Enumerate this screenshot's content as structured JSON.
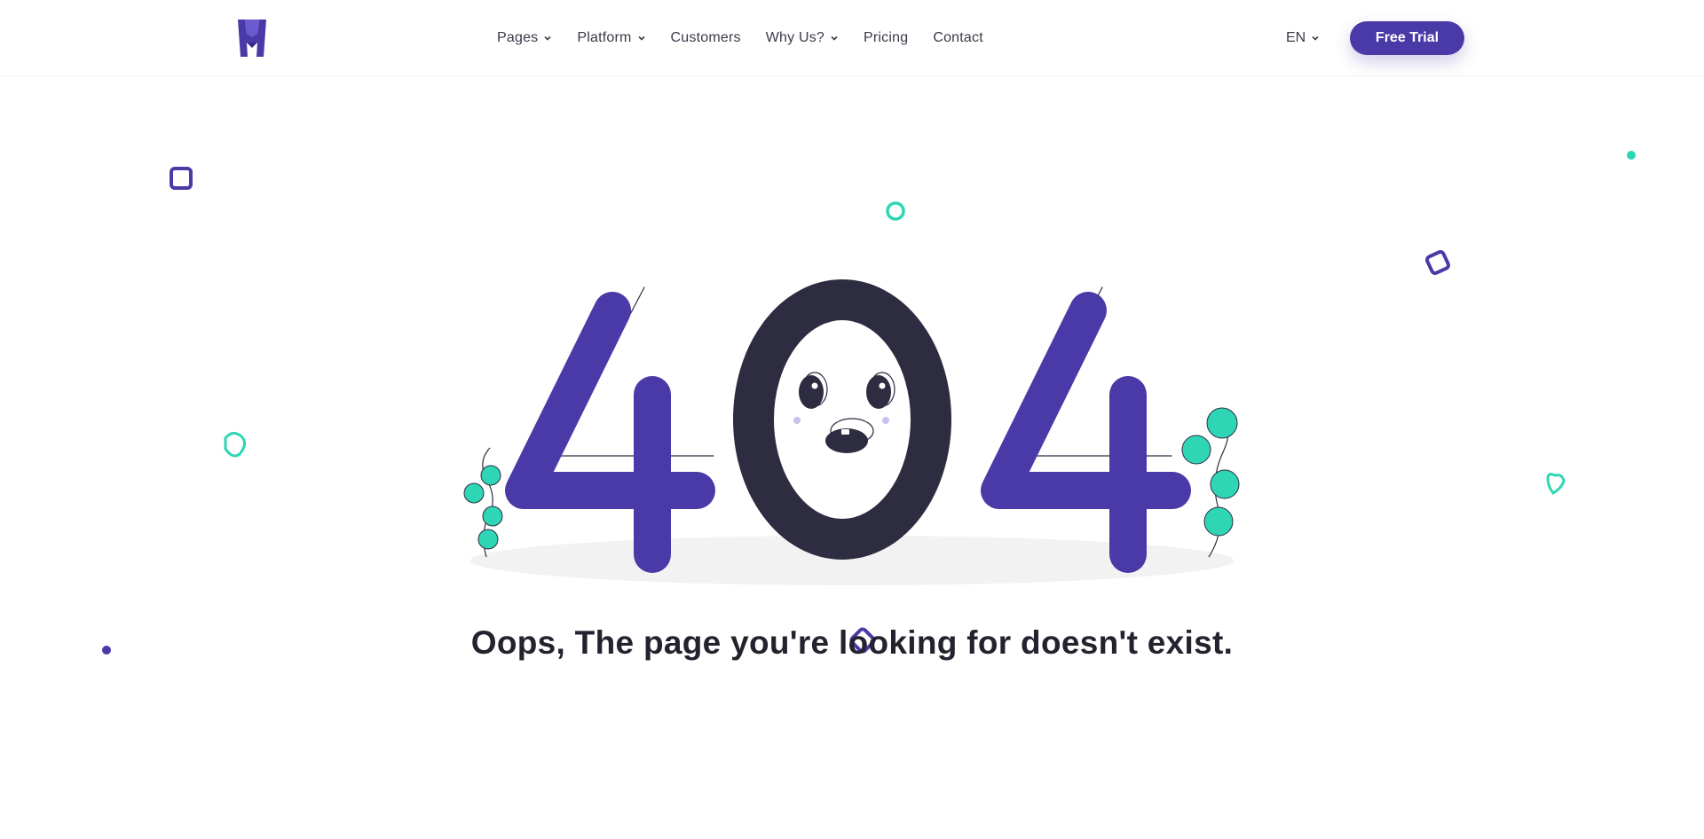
{
  "header": {
    "nav": [
      {
        "label": "Pages",
        "has_dropdown": true
      },
      {
        "label": "Platform",
        "has_dropdown": true
      },
      {
        "label": "Customers",
        "has_dropdown": false
      },
      {
        "label": "Why Us?",
        "has_dropdown": true
      },
      {
        "label": "Pricing",
        "has_dropdown": false
      },
      {
        "label": "Contact",
        "has_dropdown": false
      }
    ],
    "language": "EN",
    "cta_label": "Free Trial"
  },
  "main": {
    "error_code": "404",
    "message": "Oops, The page you're looking for doesn't exist."
  },
  "colors": {
    "brand": "#4a3aa8",
    "dark": "#2d2c40",
    "accent": "#2fd6b5"
  }
}
